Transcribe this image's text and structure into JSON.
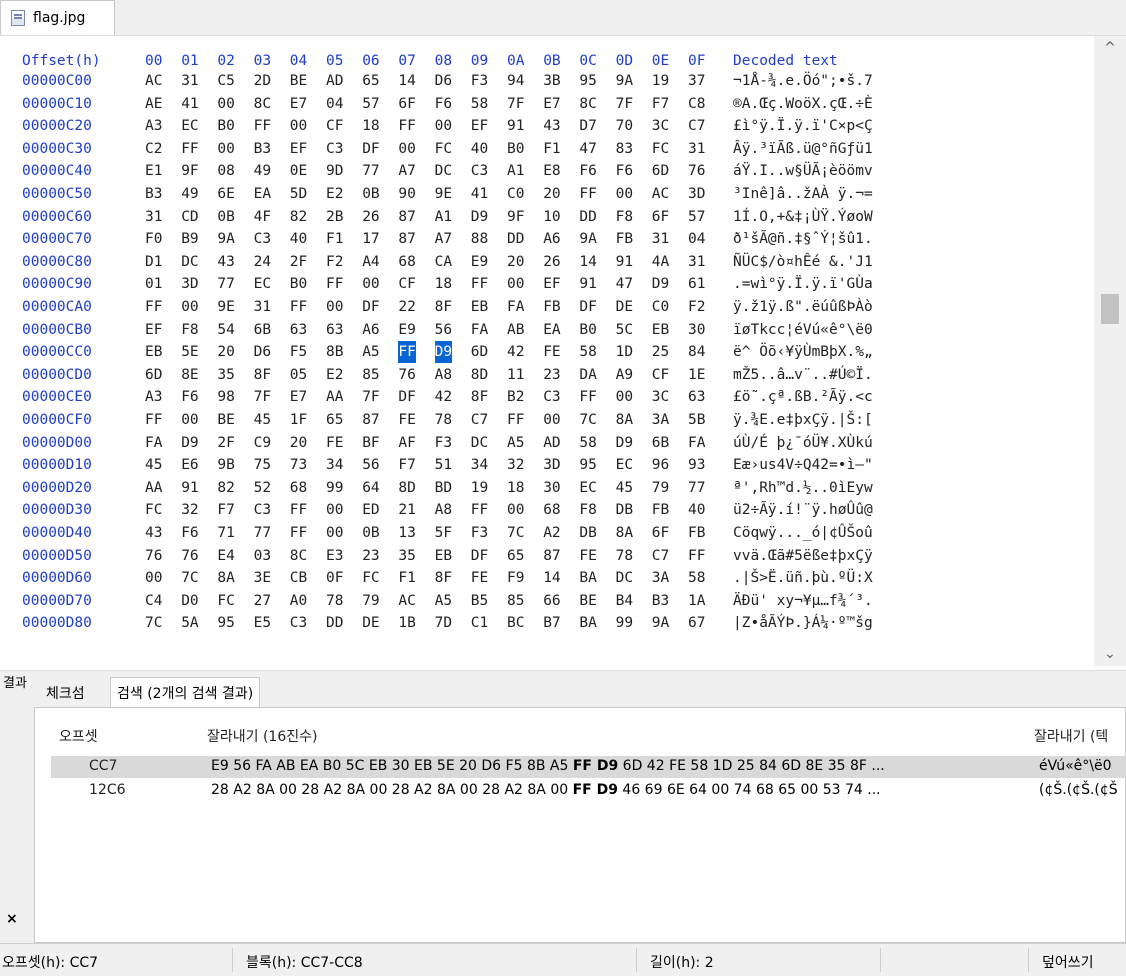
{
  "tab": {
    "file_name": "flag.jpg",
    "icon": "jpg-file-icon"
  },
  "hex_header": {
    "offset_label": "Offset(h)",
    "columns": [
      "00",
      "01",
      "02",
      "03",
      "04",
      "05",
      "06",
      "07",
      "08",
      "09",
      "0A",
      "0B",
      "0C",
      "0D",
      "0E",
      "0F"
    ],
    "decoded_label": "Decoded text"
  },
  "hex_rows": [
    {
      "offset": "00000C00",
      "bytes": [
        "AC",
        "31",
        "C5",
        "2D",
        "BE",
        "AD",
        "65",
        "14",
        "D6",
        "F3",
        "94",
        "3B",
        "95",
        "9A",
        "19",
        "37"
      ],
      "decoded": "¬1Å-¾.e.Öó\";•š.7"
    },
    {
      "offset": "00000C10",
      "bytes": [
        "AE",
        "41",
        "00",
        "8C",
        "E7",
        "04",
        "57",
        "6F",
        "F6",
        "58",
        "7F",
        "E7",
        "8C",
        "7F",
        "F7",
        "C8"
      ],
      "decoded": "®A.Œç.WoöX.çŒ.÷È"
    },
    {
      "offset": "00000C20",
      "bytes": [
        "A3",
        "EC",
        "B0",
        "FF",
        "00",
        "CF",
        "18",
        "FF",
        "00",
        "EF",
        "91",
        "43",
        "D7",
        "70",
        "3C",
        "C7"
      ],
      "decoded": "£ì°ÿ.Ï.ÿ.ï'C×p<Ç"
    },
    {
      "offset": "00000C30",
      "bytes": [
        "C2",
        "FF",
        "00",
        "B3",
        "EF",
        "C3",
        "DF",
        "00",
        "FC",
        "40",
        "B0",
        "F1",
        "47",
        "83",
        "FC",
        "31"
      ],
      "decoded": "Âÿ.³ïÃß.ü@°ñGƒü1"
    },
    {
      "offset": "00000C40",
      "bytes": [
        "E1",
        "9F",
        "08",
        "49",
        "0E",
        "9D",
        "77",
        "A7",
        "DC",
        "C3",
        "A1",
        "E8",
        "F6",
        "F6",
        "6D",
        "76"
      ],
      "decoded": "áŸ.I..w§ÜÃ¡èöömv"
    },
    {
      "offset": "00000C50",
      "bytes": [
        "B3",
        "49",
        "6E",
        "EA",
        "5D",
        "E2",
        "0B",
        "90",
        "9E",
        "41",
        "C0",
        "20",
        "FF",
        "00",
        "AC",
        "3D"
      ],
      "decoded": "³Inê]â..žAÀ ÿ.¬="
    },
    {
      "offset": "00000C60",
      "bytes": [
        "31",
        "CD",
        "0B",
        "4F",
        "82",
        "2B",
        "26",
        "87",
        "A1",
        "D9",
        "9F",
        "10",
        "DD",
        "F8",
        "6F",
        "57"
      ],
      "decoded": "1Í.O,+&‡¡ÙŸ.ÝøoW"
    },
    {
      "offset": "00000C70",
      "bytes": [
        "F0",
        "B9",
        "9A",
        "C3",
        "40",
        "F1",
        "17",
        "87",
        "A7",
        "88",
        "DD",
        "A6",
        "9A",
        "FB",
        "31",
        "04"
      ],
      "decoded": "ð¹šÃ@ñ.‡§ˆÝ¦šû1."
    },
    {
      "offset": "00000C80",
      "bytes": [
        "D1",
        "DC",
        "43",
        "24",
        "2F",
        "F2",
        "A4",
        "68",
        "CA",
        "E9",
        "20",
        "26",
        "14",
        "91",
        "4A",
        "31"
      ],
      "decoded": "ÑÜC$/ò¤hÊé &.'J1"
    },
    {
      "offset": "00000C90",
      "bytes": [
        "01",
        "3D",
        "77",
        "EC",
        "B0",
        "FF",
        "00",
        "CF",
        "18",
        "FF",
        "00",
        "EF",
        "91",
        "47",
        "D9",
        "61"
      ],
      "decoded": ".=wì°ÿ.Ï.ÿ.ï'GÙa"
    },
    {
      "offset": "00000CA0",
      "bytes": [
        "FF",
        "00",
        "9E",
        "31",
        "FF",
        "00",
        "DF",
        "22",
        "8F",
        "EB",
        "FA",
        "FB",
        "DF",
        "DE",
        "C0",
        "F2"
      ],
      "decoded": "ÿ.ž1ÿ.ß\".ëúûßÞÀò"
    },
    {
      "offset": "00000CB0",
      "bytes": [
        "EF",
        "F8",
        "54",
        "6B",
        "63",
        "63",
        "A6",
        "E9",
        "56",
        "FA",
        "AB",
        "EA",
        "B0",
        "5C",
        "EB",
        "30"
      ],
      "decoded": "ïøTkcc¦éVú«ê°\\ë0"
    },
    {
      "offset": "00000CC0",
      "bytes": [
        "EB",
        "5E",
        "20",
        "D6",
        "F5",
        "8B",
        "A5",
        "FF",
        "D9",
        "6D",
        "42",
        "FE",
        "58",
        "1D",
        "25",
        "84"
      ],
      "decoded": "ë^ Öõ‹¥ÿÙmBþX.%„"
    },
    {
      "offset": "00000CD0",
      "bytes": [
        "6D",
        "8E",
        "35",
        "8F",
        "05",
        "E2",
        "85",
        "76",
        "A8",
        "8D",
        "11",
        "23",
        "DA",
        "A9",
        "CF",
        "1E"
      ],
      "decoded": "mŽ5..â…v¨..#Ú©Ï."
    },
    {
      "offset": "00000CE0",
      "bytes": [
        "A3",
        "F6",
        "98",
        "7F",
        "E7",
        "AA",
        "7F",
        "DF",
        "42",
        "8F",
        "B2",
        "C3",
        "FF",
        "00",
        "3C",
        "63"
      ],
      "decoded": "£ö˜.çª.ßB.²Ãÿ.<c"
    },
    {
      "offset": "00000CF0",
      "bytes": [
        "FF",
        "00",
        "BE",
        "45",
        "1F",
        "65",
        "87",
        "FE",
        "78",
        "C7",
        "FF",
        "00",
        "7C",
        "8A",
        "3A",
        "5B"
      ],
      "decoded": "ÿ.¾E.e‡þxÇÿ.|Š:["
    },
    {
      "offset": "00000D00",
      "bytes": [
        "FA",
        "D9",
        "2F",
        "C9",
        "20",
        "FE",
        "BF",
        "AF",
        "F3",
        "DC",
        "A5",
        "AD",
        "58",
        "D9",
        "6B",
        "FA"
      ],
      "decoded": "úÙ/É þ¿¯óÜ¥.XÙkú"
    },
    {
      "offset": "00000D10",
      "bytes": [
        "45",
        "E6",
        "9B",
        "75",
        "73",
        "34",
        "56",
        "F7",
        "51",
        "34",
        "32",
        "3D",
        "95",
        "EC",
        "96",
        "93"
      ],
      "decoded": "Eæ›us4V÷Q42=•ì–\""
    },
    {
      "offset": "00000D20",
      "bytes": [
        "AA",
        "91",
        "82",
        "52",
        "68",
        "99",
        "64",
        "8D",
        "BD",
        "19",
        "18",
        "30",
        "EC",
        "45",
        "79",
        "77"
      ],
      "decoded": "ª',Rh™d.½..0ìEyw"
    },
    {
      "offset": "00000D30",
      "bytes": [
        "FC",
        "32",
        "F7",
        "C3",
        "FF",
        "00",
        "ED",
        "21",
        "A8",
        "FF",
        "00",
        "68",
        "F8",
        "DB",
        "FB",
        "40"
      ],
      "decoded": "ü2÷Ãÿ.í!¨ÿ.høÛû@"
    },
    {
      "offset": "00000D40",
      "bytes": [
        "43",
        "F6",
        "71",
        "77",
        "FF",
        "00",
        "0B",
        "13",
        "5F",
        "F3",
        "7C",
        "A2",
        "DB",
        "8A",
        "6F",
        "FB"
      ],
      "decoded": "Cöqwÿ..._ó|¢ÛŠoû"
    },
    {
      "offset": "00000D50",
      "bytes": [
        "76",
        "76",
        "E4",
        "03",
        "8C",
        "E3",
        "23",
        "35",
        "EB",
        "DF",
        "65",
        "87",
        "FE",
        "78",
        "C7",
        "FF"
      ],
      "decoded": "vvä.Œã#5ëße‡þxÇÿ"
    },
    {
      "offset": "00000D60",
      "bytes": [
        "00",
        "7C",
        "8A",
        "3E",
        "CB",
        "0F",
        "FC",
        "F1",
        "8F",
        "FE",
        "F9",
        "14",
        "BA",
        "DC",
        "3A",
        "58"
      ],
      "decoded": ".|Š>Ë.üñ.þù.ºÜ:X"
    },
    {
      "offset": "00000D70",
      "bytes": [
        "C4",
        "D0",
        "FC",
        "27",
        "A0",
        "78",
        "79",
        "AC",
        "A5",
        "B5",
        "85",
        "66",
        "BE",
        "B4",
        "B3",
        "1A"
      ],
      "decoded": "ÄÐü' xy¬¥µ…f¾´³."
    },
    {
      "offset": "00000D80",
      "bytes": [
        "7C",
        "5A",
        "95",
        "E5",
        "C3",
        "DD",
        "DE",
        "1B",
        "7D",
        "C1",
        "BC",
        "B7",
        "BA",
        "99",
        "9A",
        "67"
      ],
      "decoded": "|Z•åÃÝÞ.}Á¼·º™šg"
    }
  ],
  "results_panel": {
    "side_label": "결과",
    "close_label": "×",
    "tabs": [
      "체크섬",
      "검색 (2개의 검색 결과)"
    ],
    "columns": [
      "오프셋",
      "잘라내기 (16진수)",
      "잘라내기 (텍"
    ],
    "rows": [
      {
        "offset": "CC7",
        "hex_before": "E9 56 FA AB EA B0 5C EB 30 EB 5E 20 D6 F5 8B A5 ",
        "match": "FF D9",
        "hex_after": " 6D 42 FE 58 1D 25 84 6D 8E 35 8F ...",
        "text": "éVú«ê°\\ë0"
      },
      {
        "offset": "12C6",
        "hex_before": "28 A2 8A 00 28 A2 8A 00 28 A2 8A 00 28 A2 8A 00 ",
        "match": "FF D9",
        "hex_after": " 46 69 6E 64 00 74 68 65 00 53 74 ...",
        "text": "(¢Š.(¢Š.(¢Š"
      }
    ]
  },
  "status_bar": {
    "offset": "오프셋(h): CC7",
    "block": "블록(h): CC7-CC8",
    "length": "길이(h): 2",
    "mode": "덮어쓰기"
  },
  "colors": {
    "selection": "#0a64d2",
    "header_text": "#1f3dc8"
  }
}
